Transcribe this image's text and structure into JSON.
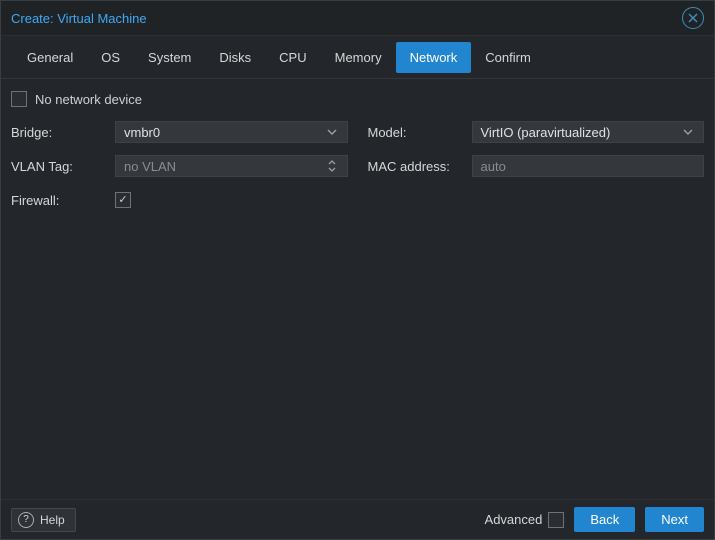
{
  "window": {
    "title": "Create: Virtual Machine"
  },
  "tabs": [
    {
      "label": "General"
    },
    {
      "label": "OS"
    },
    {
      "label": "System"
    },
    {
      "label": "Disks"
    },
    {
      "label": "CPU"
    },
    {
      "label": "Memory"
    },
    {
      "label": "Network"
    },
    {
      "label": "Confirm"
    }
  ],
  "active_tab_index": 6,
  "form": {
    "no_network": {
      "label": "No network device",
      "checked": false
    },
    "bridge": {
      "label": "Bridge:",
      "value": "vmbr0"
    },
    "vlan_tag": {
      "label": "VLAN Tag:",
      "placeholder": "no VLAN",
      "value": ""
    },
    "firewall": {
      "label": "Firewall:",
      "checked": true
    },
    "model": {
      "label": "Model:",
      "value": "VirtIO (paravirtualized)"
    },
    "mac": {
      "label": "MAC address:",
      "placeholder": "auto",
      "value": ""
    }
  },
  "footer": {
    "help_label": "Help",
    "advanced_label": "Advanced",
    "advanced_checked": false,
    "back_label": "Back",
    "next_label": "Next"
  }
}
